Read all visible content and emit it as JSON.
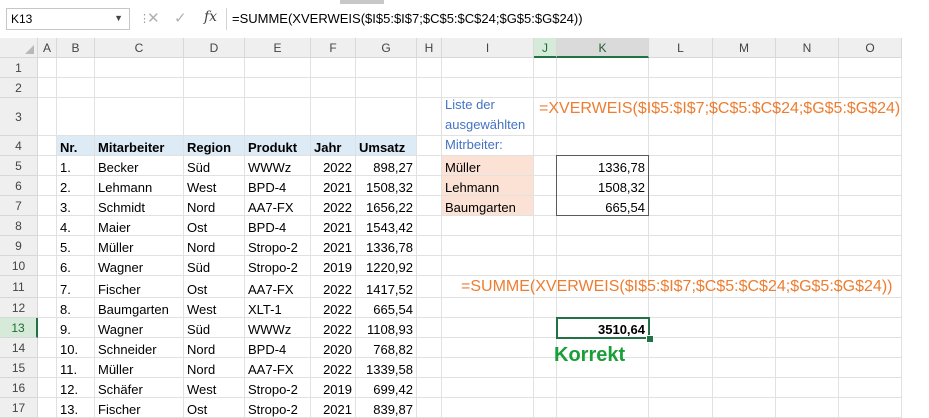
{
  "formula_bar": {
    "name_box": "K13",
    "fx_label": "fx",
    "cancel_glyph": "✕",
    "enter_glyph": "✓",
    "formula": "=SUMME(XVERWEIS($I$5:$I$7;$C$5:$C$24;$G$5:$G$24))"
  },
  "columns": [
    "A",
    "B",
    "C",
    "D",
    "E",
    "F",
    "G",
    "H",
    "I",
    "J",
    "K",
    "L",
    "M",
    "N",
    "O"
  ],
  "rows": [
    "1",
    "2",
    "3",
    "4",
    "5",
    "6",
    "7",
    "8",
    "9",
    "10",
    "11",
    "12",
    "13",
    "14",
    "15",
    "16",
    "17"
  ],
  "table": {
    "headers": {
      "nr": "Nr.",
      "mitarbeiter": "Mitarbeiter",
      "region": "Region",
      "produkt": "Produkt",
      "jahr": "Jahr",
      "umsatz": "Umsatz"
    },
    "rows": [
      [
        "1.",
        "Becker",
        "Süd",
        "WWWz",
        "2022",
        "898,27"
      ],
      [
        "2.",
        "Lehmann",
        "West",
        "BPD-4",
        "2021",
        "1508,32"
      ],
      [
        "3.",
        "Schmidt",
        "Nord",
        "AA7-FX",
        "2022",
        "1656,22"
      ],
      [
        "4.",
        "Maier",
        "Ost",
        "BPD-4",
        "2021",
        "1543,42"
      ],
      [
        "5.",
        "Müller",
        "Nord",
        "Stropo-2",
        "2021",
        "1336,78"
      ],
      [
        "6.",
        "Wagner",
        "Süd",
        "Stropo-2",
        "2019",
        "1220,92"
      ],
      [
        "7.",
        "Fischer",
        "Ost",
        "AA7-FX",
        "2022",
        "1417,52"
      ],
      [
        "8.",
        "Baumgarten",
        "West",
        "XLT-1",
        "2022",
        "665,54"
      ],
      [
        "9.",
        "Wagner",
        "Süd",
        "WWWz",
        "2022",
        "1108,93"
      ],
      [
        "10.",
        "Schneider",
        "Nord",
        "BPD-4",
        "2020",
        "768,82"
      ],
      [
        "11.",
        "Müller",
        "Nord",
        "AA7-FX",
        "2022",
        "1339,58"
      ],
      [
        "12.",
        "Schäfer",
        "West",
        "Stropo-2",
        "2019",
        "699,42"
      ],
      [
        "13.",
        "Fischer",
        "Ost",
        "Stropo-2",
        "2021",
        "839,87"
      ]
    ]
  },
  "selection": {
    "label_line1": "Liste der",
    "label_line2": "ausgewählten",
    "label_line3": "Mitrbeiter:",
    "names": [
      "Müller",
      "Lehmann",
      "Baumgarten"
    ],
    "values": [
      "1336,78",
      "1508,32",
      "665,54"
    ],
    "xverweis_formula": "=XVERWEIS($I$5:$I$7;$C$5:$C$24;$G$5:$G$24)",
    "summe_formula": "=SUMME(XVERWEIS($I$5:$I$7;$C$5:$C$24;$G$5:$G$24))",
    "total": "3510,64",
    "korrekt": "Korrekt"
  },
  "colors": {
    "accent": "#217346",
    "header_fill": "#ddebf7",
    "peach_fill": "#fbe2d5",
    "orange_text": "#ed7d31",
    "blue_text": "#4472c4",
    "green_text": "#1a9e37"
  }
}
